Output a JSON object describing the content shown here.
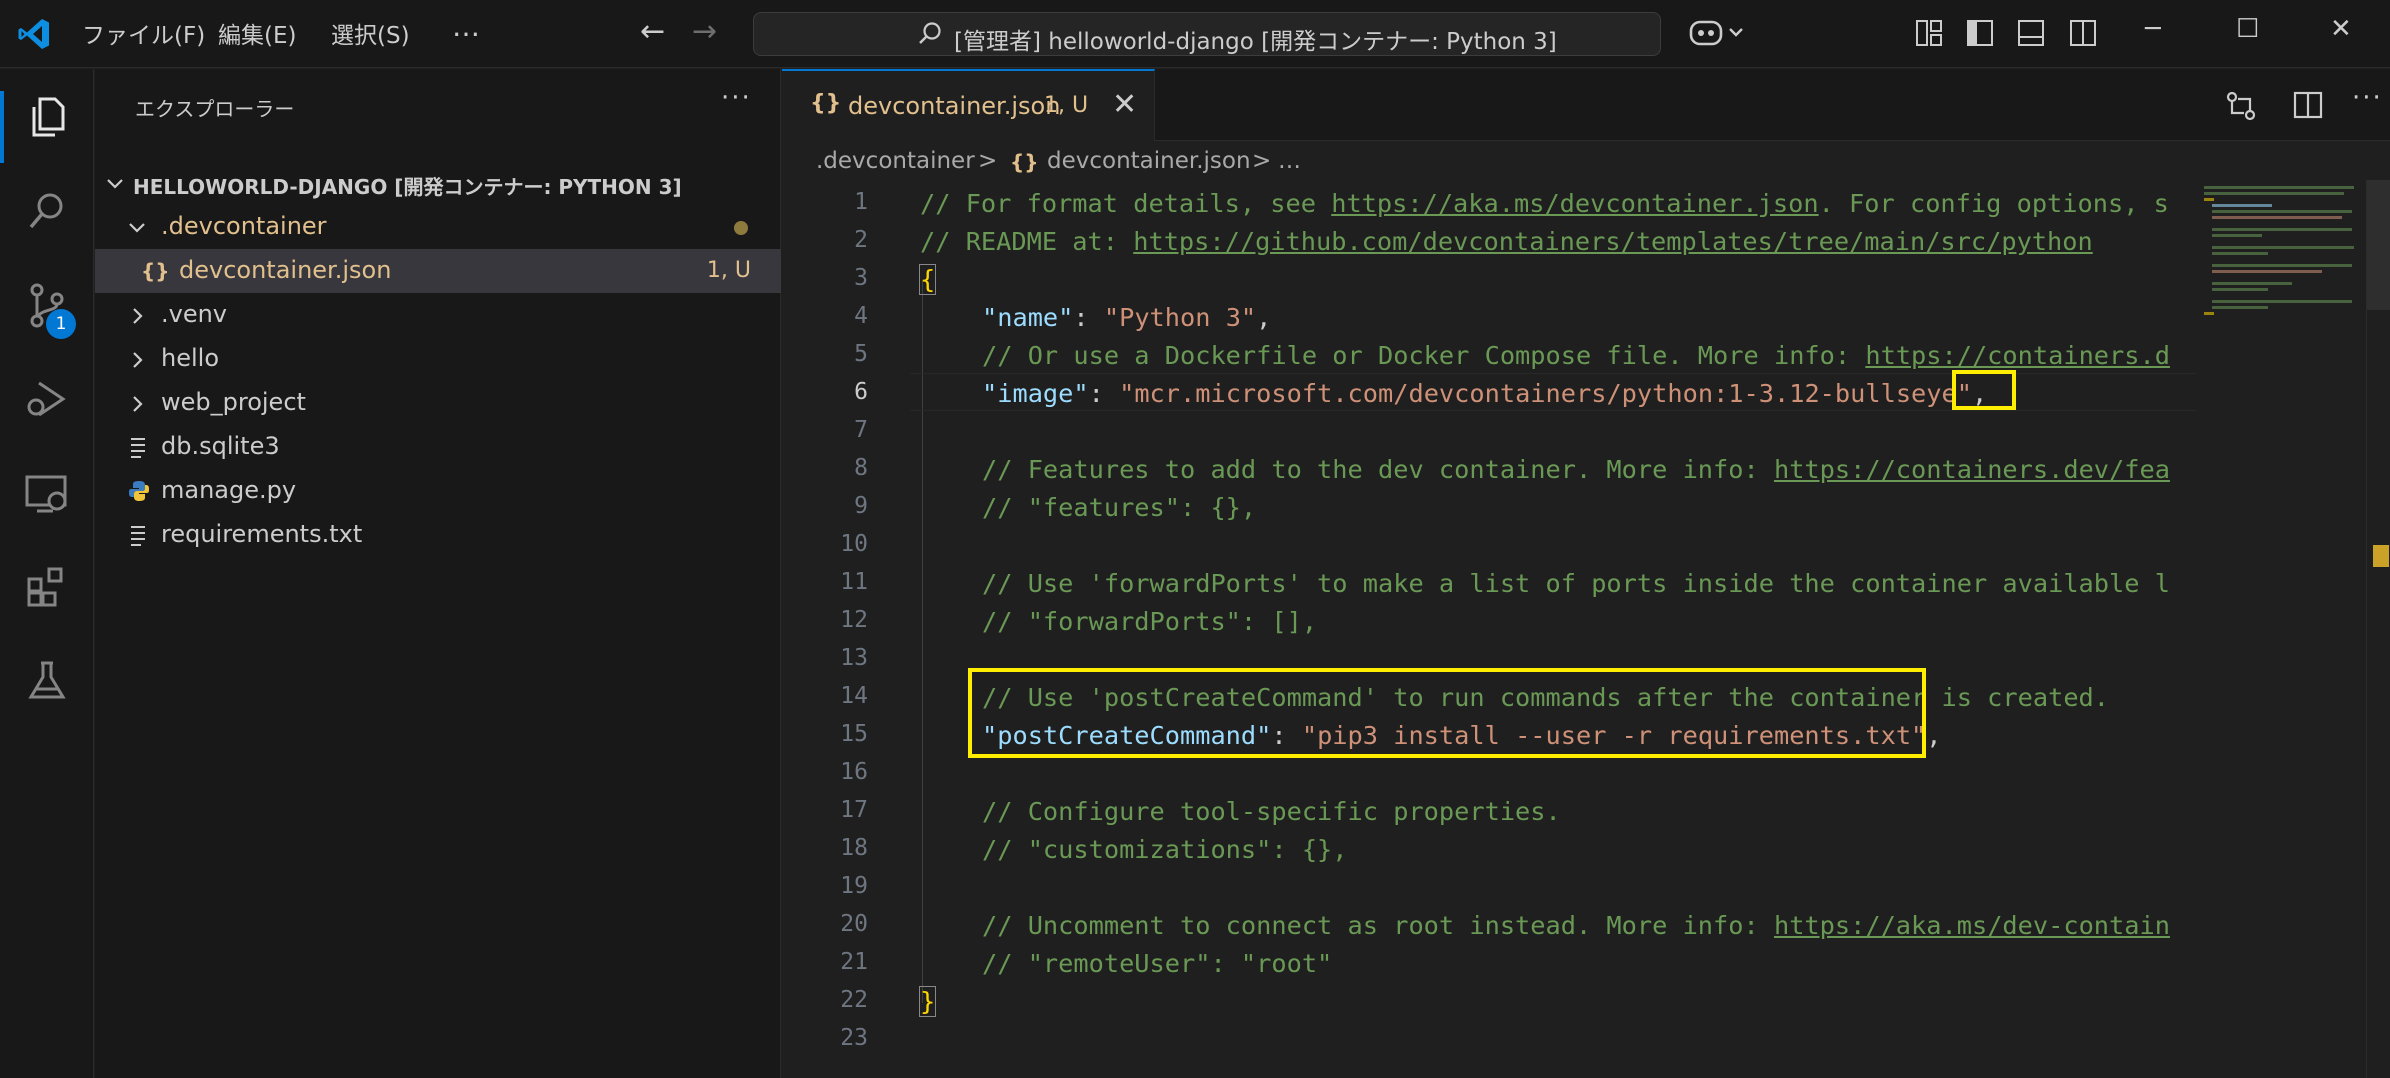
{
  "titlebar": {
    "menu": [
      "ファイル(F)",
      "編集(E)",
      "選択(S)",
      "…"
    ],
    "command_center": "[管理者] helloworld-django [開発コンテナー: Python 3]",
    "window_controls": [
      "─",
      "☐",
      "✕"
    ]
  },
  "activitybar": {
    "items": [
      "explorer-icon",
      "search-icon",
      "source-control-icon",
      "run-debug-icon",
      "remote-explorer-icon",
      "extensions-icon",
      "testing-icon"
    ],
    "source_control_badge": "1"
  },
  "sidebar": {
    "title": "エクスプローラー",
    "more": "···",
    "root": "HELLOWORLD-DJANGO [開発コンテナー: PYTHON 3]",
    "tree": [
      {
        "label": ".devcontainer",
        "kind": "folder-open",
        "modified": true
      },
      {
        "label": "devcontainer.json",
        "kind": "json",
        "status": "1, U",
        "selected": true
      },
      {
        "label": ".venv",
        "kind": "folder"
      },
      {
        "label": "hello",
        "kind": "folder"
      },
      {
        "label": "web_project",
        "kind": "folder"
      },
      {
        "label": "db.sqlite3",
        "kind": "file"
      },
      {
        "label": "manage.py",
        "kind": "python"
      },
      {
        "label": "requirements.txt",
        "kind": "file"
      }
    ]
  },
  "editor": {
    "tab": {
      "icon": "{}",
      "label": "devcontainer.json",
      "badge": "1, U",
      "close": "✕"
    },
    "breadcrumb": [
      ".devcontainer",
      ">",
      "{}",
      "devcontainer.json",
      ">",
      "…"
    ],
    "current_line": 6,
    "lines": [
      {
        "n": "1"
      },
      {
        "n": "2"
      },
      {
        "n": "3"
      },
      {
        "n": "4"
      },
      {
        "n": "5"
      },
      {
        "n": "6"
      },
      {
        "n": "7"
      },
      {
        "n": "8"
      },
      {
        "n": "9"
      },
      {
        "n": "10"
      },
      {
        "n": "11"
      },
      {
        "n": "12"
      },
      {
        "n": "13"
      },
      {
        "n": "14"
      },
      {
        "n": "15"
      },
      {
        "n": "16"
      },
      {
        "n": "17"
      },
      {
        "n": "18"
      },
      {
        "n": "19"
      },
      {
        "n": "20"
      },
      {
        "n": "21"
      },
      {
        "n": "22"
      },
      {
        "n": "23"
      }
    ],
    "code": {
      "l1_a": "// For format details, see ",
      "l1_link": "https://aka.ms/devcontainer.json",
      "l1_b": ". For config options, s",
      "l2_a": "// README at: ",
      "l2_link": "https://github.com/devcontainers/templates/tree/main/src/python",
      "l3": "{",
      "l4_key": "\"name\"",
      "l4_sep": ": ",
      "l4_val": "\"Python 3\"",
      "l4_end": ",",
      "l5_a": "// Or use a Dockerfile or Docker Compose file. More info: ",
      "l5_link": "https://containers.d",
      "l6_key": "\"image\"",
      "l6_sep": ": ",
      "l6_val": "\"mcr.microsoft.com/devcontainers/python:1-3.12-bullseye\"",
      "l6_end": ",",
      "l8_a": "// Features to add to the dev container. More info: ",
      "l8_link": "https://containers.dev/fea",
      "l9": "// \"features\": {},",
      "l11": "// Use 'forwardPorts' to make a list of ports inside the container available l",
      "l12": "// \"forwardPorts\": [],",
      "l14": "// Use 'postCreateCommand' to run commands after the container is created.",
      "l15_key": "\"postCreateCommand\"",
      "l15_sep": ": ",
      "l15_val": "\"pip3 install --user -r requirements.txt\"",
      "l15_end": ",",
      "l17": "// Configure tool-specific properties.",
      "l18": "// \"customizations\": {},",
      "l20_a": "// Uncomment to connect as root instead. More info: ",
      "l20_link": "https://aka.ms/dev-contain",
      "l21": "// \"remoteUser\": \"root\"",
      "l22": "}"
    }
  },
  "colors": {
    "accent": "#0078d4",
    "highlight_box": "#ffee00",
    "comment": "#6a9955",
    "json_key": "#9cdcfe",
    "string": "#ce9178",
    "modified": "#e2c08d"
  }
}
